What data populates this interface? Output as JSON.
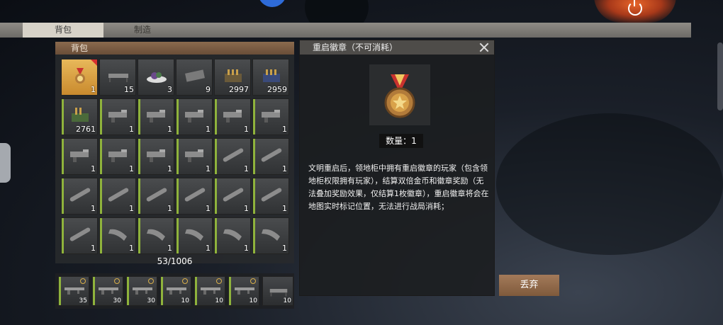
{
  "tabs": {
    "backpack": "背包",
    "crafting": "制造"
  },
  "backpack": {
    "title": "背包",
    "capacity": "53/1006",
    "slots": [
      {
        "icon": "medal-icon",
        "count": "1",
        "selected": true
      },
      {
        "icon": "bed-icon",
        "count": "15"
      },
      {
        "icon": "food-plate-icon",
        "count": "3"
      },
      {
        "icon": "armor-plate-icon",
        "count": "9"
      },
      {
        "icon": "ammo-box-icon",
        "count": "2997"
      },
      {
        "icon": "ammo-box-blue-icon",
        "count": "2959"
      },
      {
        "icon": "ammo-green-icon",
        "count": "2761"
      },
      {
        "icon": "gun-part-icon",
        "count": "1"
      },
      {
        "icon": "gun-part-icon",
        "count": "1"
      },
      {
        "icon": "gun-part-icon",
        "count": "1"
      },
      {
        "icon": "gun-part-icon",
        "count": "1"
      },
      {
        "icon": "gun-part-icon",
        "count": "1"
      },
      {
        "icon": "gun-part-icon",
        "count": "1"
      },
      {
        "icon": "gun-part-icon",
        "count": "1"
      },
      {
        "icon": "gun-part-icon",
        "count": "1"
      },
      {
        "icon": "gun-part-icon",
        "count": "1"
      },
      {
        "icon": "silencer-icon",
        "count": "1"
      },
      {
        "icon": "silencer-icon",
        "count": "1"
      },
      {
        "icon": "silencer-icon",
        "count": "1"
      },
      {
        "icon": "silencer-icon",
        "count": "1"
      },
      {
        "icon": "silencer-icon",
        "count": "1"
      },
      {
        "icon": "silencer-icon",
        "count": "1"
      },
      {
        "icon": "silencer-icon",
        "count": "1"
      },
      {
        "icon": "silencer-icon",
        "count": "1"
      },
      {
        "icon": "silencer-icon",
        "count": "1"
      },
      {
        "icon": "magazine-icon",
        "count": "1"
      },
      {
        "icon": "magazine-icon",
        "count": "1"
      },
      {
        "icon": "magazine-icon",
        "count": "1"
      },
      {
        "icon": "magazine-icon",
        "count": "1"
      },
      {
        "icon": "magazine-icon",
        "count": "1"
      }
    ]
  },
  "hotbar": [
    {
      "icon": "rifle-icon",
      "count": "35"
    },
    {
      "icon": "rifle-icon",
      "count": "30"
    },
    {
      "icon": "rifle-icon",
      "count": "30"
    },
    {
      "icon": "rifle-icon",
      "count": "10"
    },
    {
      "icon": "rifle-icon",
      "count": "10"
    },
    {
      "icon": "rifle-icon",
      "count": "10"
    },
    {
      "icon": "bed-icon",
      "count": "10"
    }
  ],
  "detail": {
    "title": "重启徽章（不可消耗）",
    "quantity": "数量：1",
    "description": "文明重启后，领地柜中拥有重启徽章的玩家（包含领地柜权限拥有玩家），结算双倍金币和徽章奖励（无法叠加奖励效果，仅结算1枚徽章），重启徽章将会在地图实时标记位置，无法进行战局消耗；",
    "drop_label": "丢弃"
  },
  "colors": {
    "accent_green": "#8fb33c",
    "selected_gold": "#d9a24a",
    "title_brown": "#7a5a40",
    "button_brown": "#93694a"
  }
}
